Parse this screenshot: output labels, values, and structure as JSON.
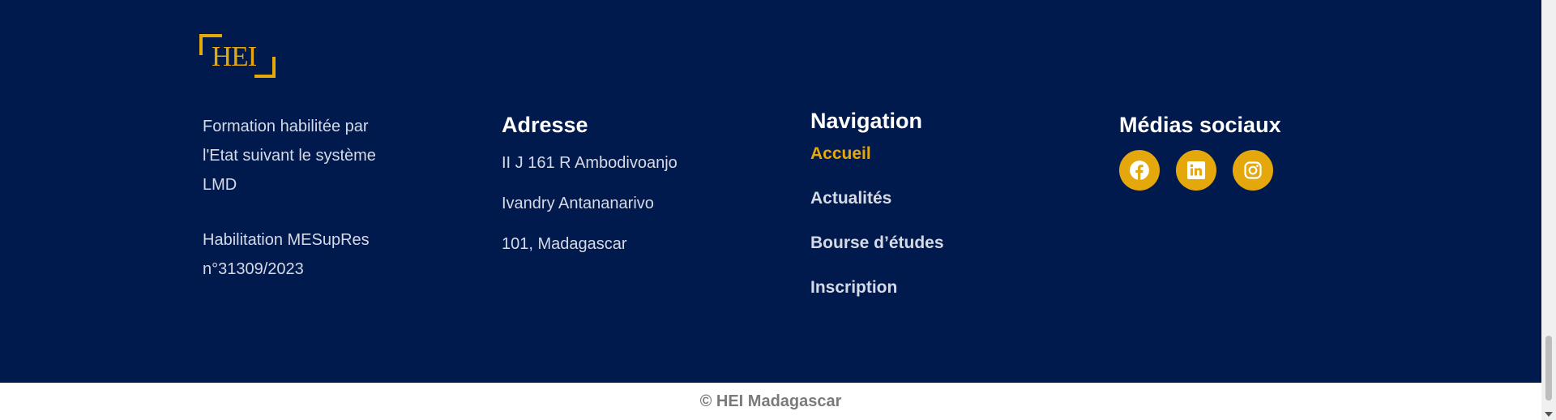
{
  "logo": {
    "text": "HEI"
  },
  "about": {
    "line1": "Formation habilitée par l'Etat suivant le système LMD",
    "line2": "Habilitation MESupRes n°31309/2023"
  },
  "address": {
    "heading": "Adresse",
    "lines": [
      "II J 161 R Ambodivoanjo",
      "Ivandry Antananarivo",
      "101, Madagascar"
    ]
  },
  "navigation": {
    "heading": "Navigation",
    "items": [
      {
        "label": "Accueil",
        "active": true
      },
      {
        "label": "Actualités"
      },
      {
        "label": "Bourse d’études"
      },
      {
        "label": "Inscription"
      }
    ]
  },
  "social": {
    "heading": "Médias sociaux",
    "icons": [
      "facebook-icon",
      "linkedin-icon",
      "instagram-icon"
    ]
  },
  "footer": {
    "copyright": "© HEI Madagascar"
  },
  "colors": {
    "background": "#011a4d",
    "accent": "#e4a70c"
  }
}
